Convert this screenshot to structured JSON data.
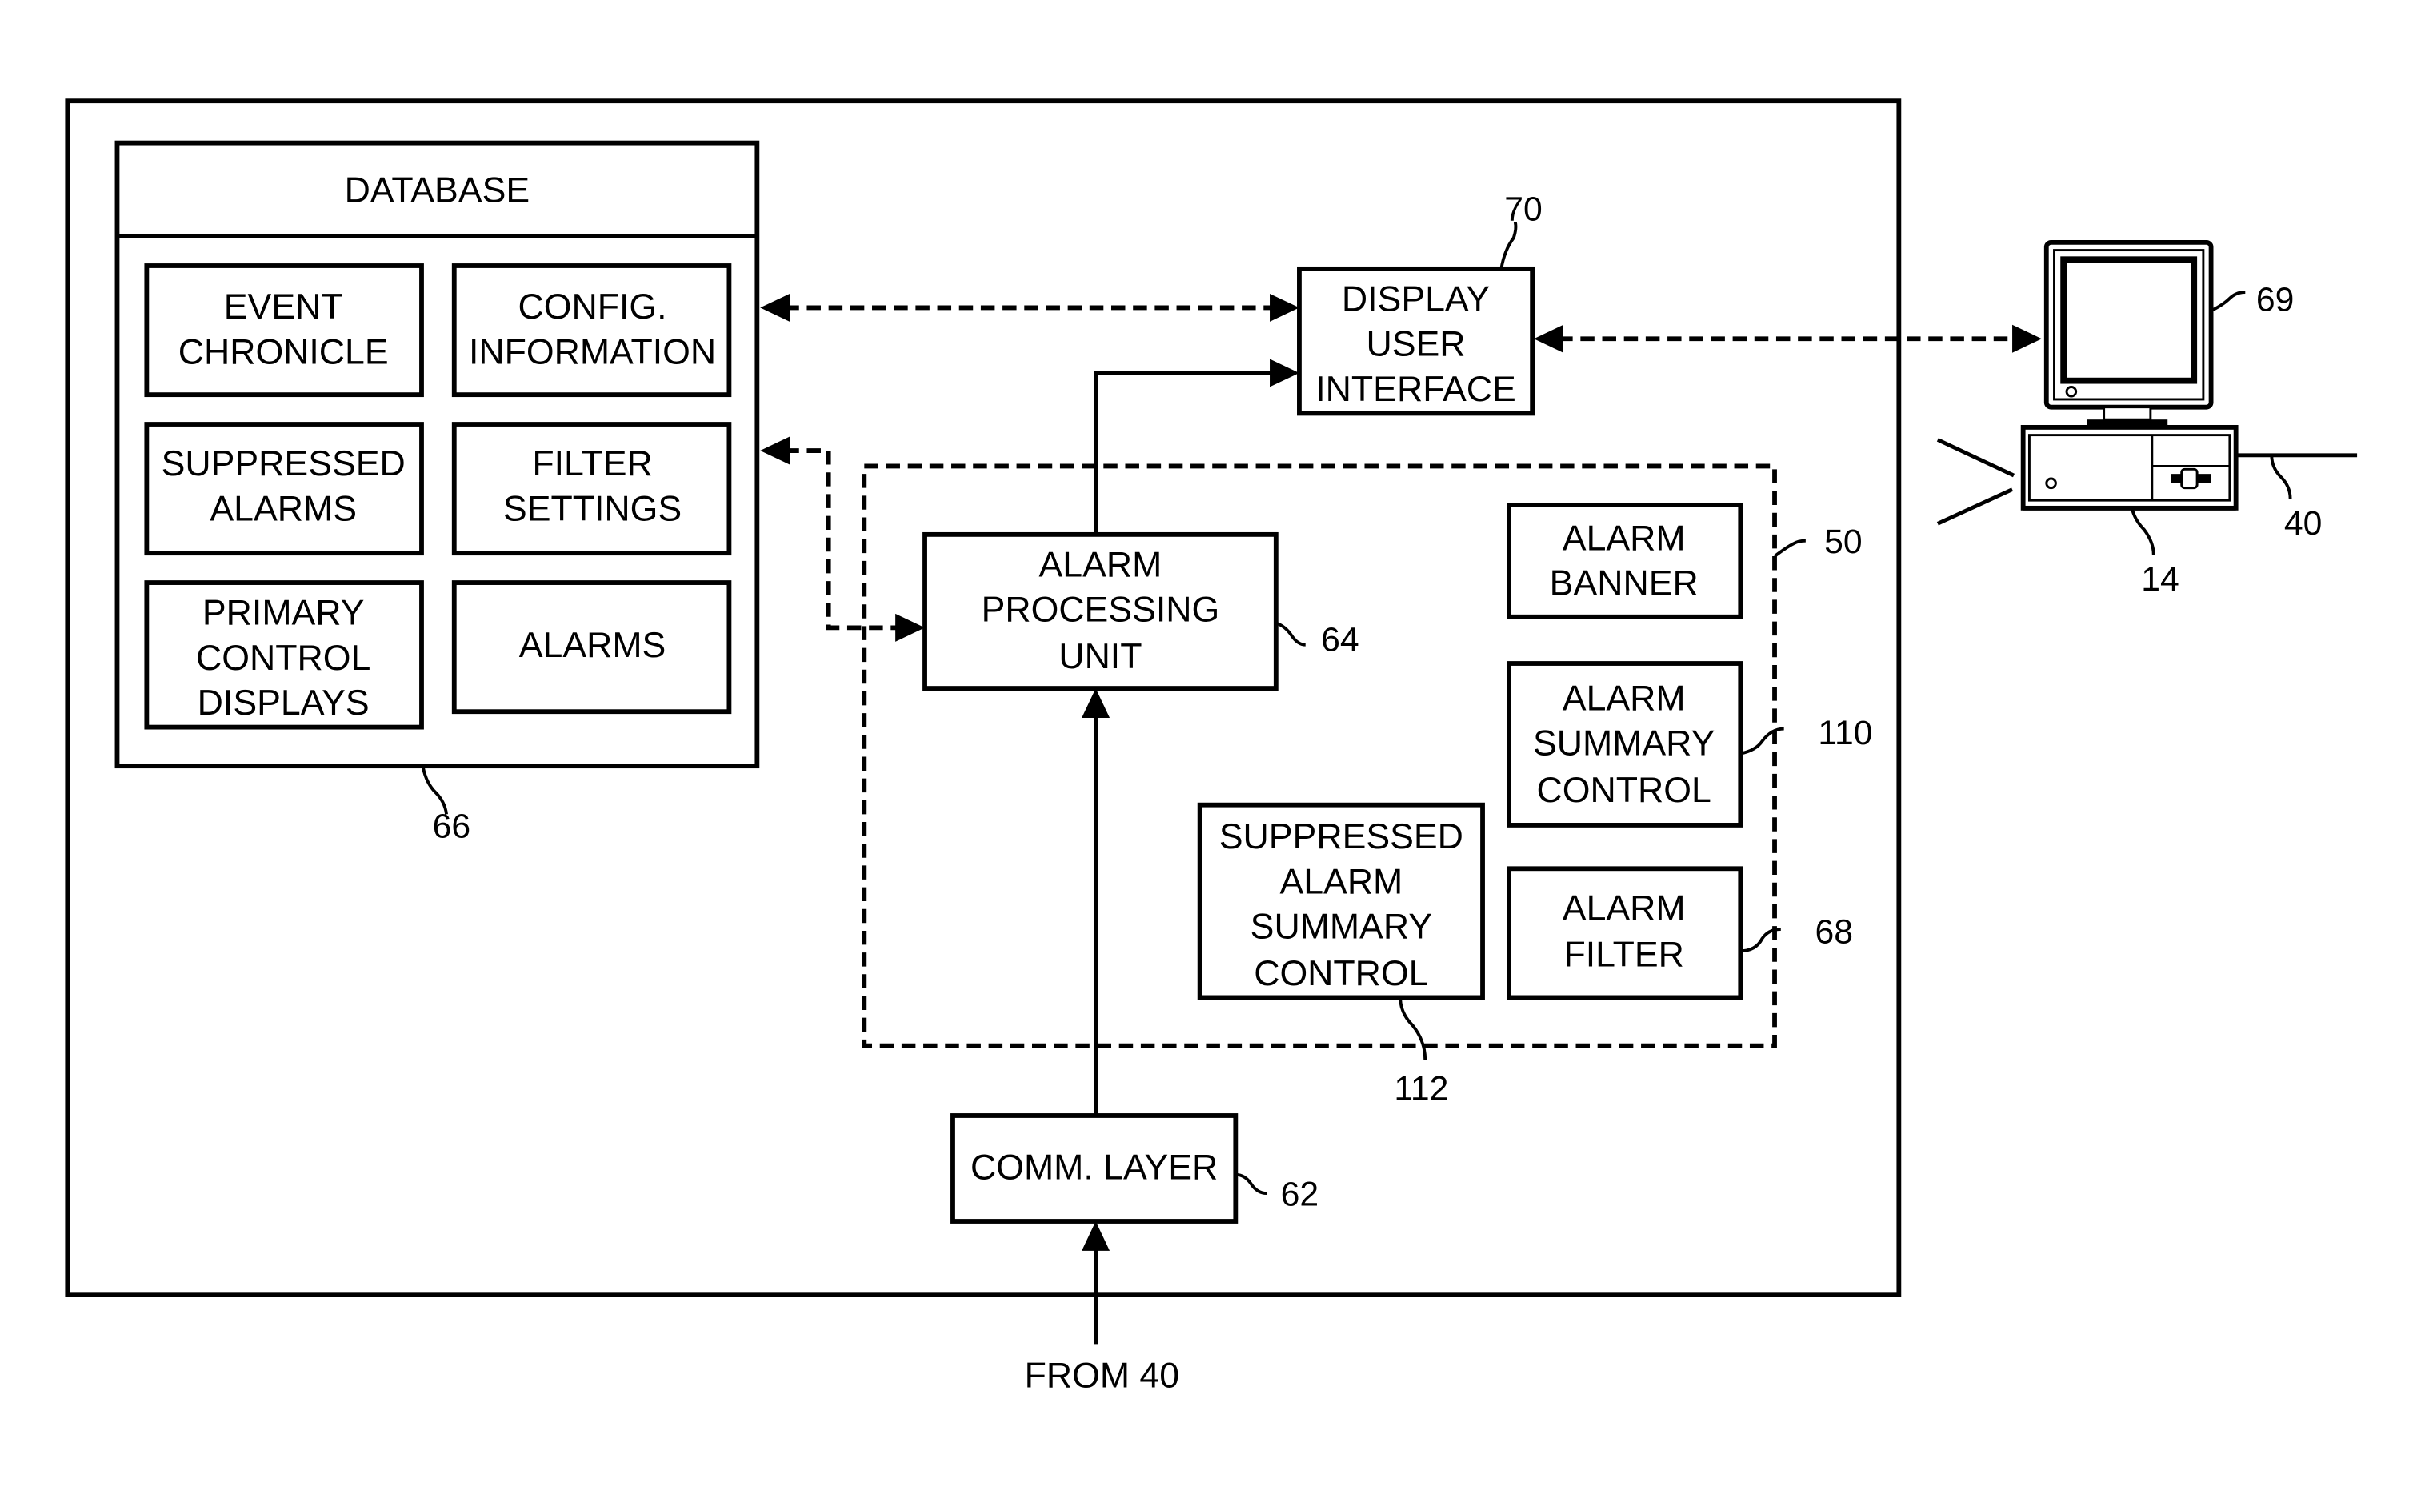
{
  "figure": {
    "database": {
      "title": "DATABASE",
      "ref": "66",
      "items": [
        {
          "lines": [
            "EVENT",
            "CHRONICLE"
          ]
        },
        {
          "lines": [
            "CONFIG.",
            "INFORMATION"
          ]
        },
        {
          "lines": [
            "SUPPRESSED",
            "ALARMS"
          ]
        },
        {
          "lines": [
            "FILTER",
            "SETTINGS"
          ]
        },
        {
          "lines": [
            "PRIMARY",
            "CONTROL",
            "DISPLAYS"
          ]
        },
        {
          "lines": [
            "ALARMS"
          ]
        }
      ]
    },
    "display_ui": {
      "lines": [
        "DISPLAY",
        "USER",
        "INTERFACE"
      ],
      "ref": "70"
    },
    "alarm_processing": {
      "lines": [
        "ALARM",
        "PROCESSING",
        "UNIT"
      ],
      "ref": "64"
    },
    "group_ref": "50",
    "alarm_banner": {
      "lines": [
        "ALARM",
        "BANNER"
      ]
    },
    "alarm_summary": {
      "lines": [
        "ALARM",
        "SUMMARY",
        "CONTROL"
      ],
      "ref": "110"
    },
    "suppressed_summary": {
      "lines": [
        "SUPPRESSED",
        "ALARM",
        "SUMMARY",
        "CONTROL"
      ],
      "ref": "112"
    },
    "alarm_filter": {
      "lines": [
        "ALARM",
        "FILTER"
      ],
      "ref": "68"
    },
    "comm_layer": {
      "lines": [
        "COMM. LAYER"
      ],
      "ref": "62"
    },
    "input_label": "FROM 40",
    "workstation": {
      "monitor_ref": "69",
      "computer_ref": "14",
      "network_ref": "40"
    }
  }
}
